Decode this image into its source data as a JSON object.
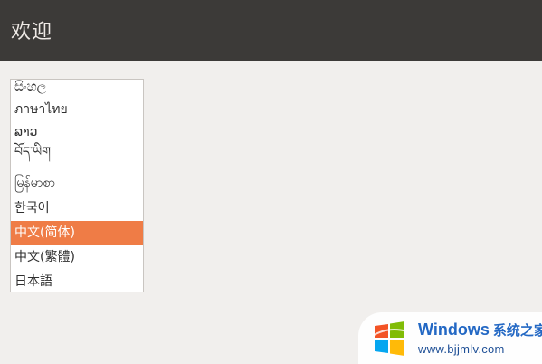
{
  "header": {
    "title": "欢迎"
  },
  "language_list": {
    "items": [
      {
        "label": "සිංහල"
      },
      {
        "label": "ภาษาไทย"
      },
      {
        "label": "ລາວ"
      },
      {
        "label": "བོད་ཡིག"
      },
      {
        "label": "မြန်မာစာ"
      },
      {
        "label": "한국어"
      },
      {
        "label": "中文(简体)",
        "selected": true
      },
      {
        "label": "中文(繁體)"
      },
      {
        "label": "日本語"
      }
    ],
    "selected_color": "#ef7c46"
  },
  "watermark": {
    "brand": "Windows",
    "brand_cn": "系统之家",
    "url": "www.bjjmlv.com",
    "logo_colors": [
      "#f35325",
      "#81bc06",
      "#05a6f0",
      "#ffba08"
    ]
  }
}
